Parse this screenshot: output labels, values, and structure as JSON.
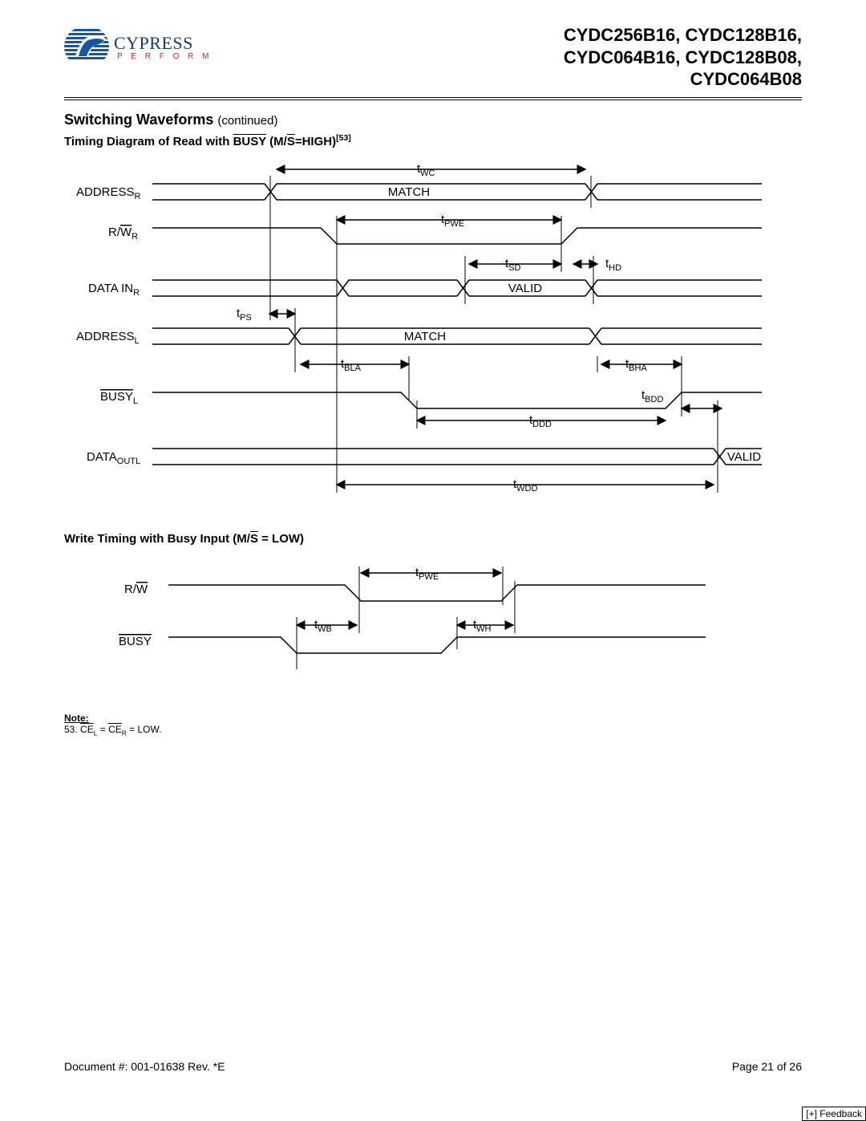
{
  "header": {
    "logo_name": "CYPRESS",
    "logo_tagline": "P E R F O R M",
    "part_numbers_line1": "CYDC256B16, CYDC128B16,",
    "part_numbers_line2": "CYDC064B16, CYDC128B08,",
    "part_numbers_line3": "CYDC064B08"
  },
  "section": {
    "title": "Switching Waveforms",
    "continued": "(continued)",
    "sub1_prefix": "Timing Diagram of Read with ",
    "sub1_busy": "BUSY",
    "sub1_mid": " (M/",
    "sub1_s": "S",
    "sub1_suffix": "=HIGH)",
    "sub1_noteref": "[53]",
    "sub2_prefix": "Write Timing with Busy Input (M/",
    "sub2_s": "S",
    "sub2_suffix": " = LOW)"
  },
  "diagram1": {
    "signals": {
      "address_r": "ADDRESS",
      "address_r_sub": "R",
      "rw_r_pre": "R/",
      "rw_r_w": "W",
      "rw_r_sub": "R",
      "data_in": "DATA IN",
      "data_in_sub": "R",
      "address_l": "ADDRESS",
      "address_l_sub": "L",
      "busy_l": "BUSY",
      "busy_l_sub": "L",
      "data_outl": "DATA",
      "data_outl_sub": "OUTL"
    },
    "labels": {
      "twc": "t",
      "twc_sub": "WC",
      "match1": "MATCH",
      "tpwe": "t",
      "tpwe_sub": "PWE",
      "tsd": "t",
      "tsd_sub": "SD",
      "thd": "t",
      "thd_sub": "HD",
      "valid1": "VALID",
      "tps": "t",
      "tps_sub": "PS",
      "match2": "MATCH",
      "tbla": "t",
      "tbla_sub": "BLA",
      "tbha": "t",
      "tbha_sub": "BHA",
      "tbdd": "t",
      "tbdd_sub": "BDD",
      "tddd": "t",
      "tddd_sub": "DDD",
      "twdd": "t",
      "twdd_sub": "WDD",
      "valid2": "VALID"
    }
  },
  "diagram2": {
    "signals": {
      "rw_pre": "R/",
      "rw_w": "W",
      "busy": "BUSY"
    },
    "labels": {
      "tpwe": "t",
      "tpwe_sub": "PWE",
      "twb": "t",
      "twb_sub": "WB",
      "twh": "t",
      "twh_sub": "WH"
    }
  },
  "note": {
    "heading": "Note:",
    "num": "53.",
    "ce": "CE",
    "sub_l": "L",
    "eq": " = ",
    "sub_r": "R",
    "tail": " = LOW."
  },
  "footer": {
    "doc": "Document #: 001-01638 Rev. *E",
    "page": "Page 21 of 26"
  },
  "feedback": {
    "text": "[+] Feedback"
  }
}
